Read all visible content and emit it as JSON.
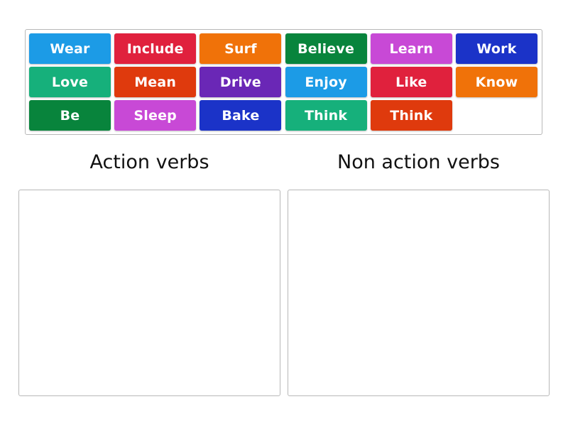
{
  "tiles": [
    {
      "label": "Wear",
      "color": "#1c9be6"
    },
    {
      "label": "Include",
      "color": "#e0213d"
    },
    {
      "label": "Surf",
      "color": "#f07209"
    },
    {
      "label": "Believe",
      "color": "#08843c"
    },
    {
      "label": "Learn",
      "color": "#c849d6"
    },
    {
      "label": "Work",
      "color": "#1b33c8"
    },
    {
      "label": "Love",
      "color": "#16b07b"
    },
    {
      "label": "Mean",
      "color": "#df3a0d"
    },
    {
      "label": "Drive",
      "color": "#6a27b6"
    },
    {
      "label": "Enjoy",
      "color": "#1c9be6"
    },
    {
      "label": "Like",
      "color": "#e0213d"
    },
    {
      "label": "Know",
      "color": "#f07209"
    },
    {
      "label": "Be",
      "color": "#08843c"
    },
    {
      "label": "Sleep",
      "color": "#c849d6"
    },
    {
      "label": "Bake",
      "color": "#1b33c8"
    },
    {
      "label": "Think",
      "color": "#16b07b"
    },
    {
      "label": "Think",
      "color": "#df3a0d"
    }
  ],
  "groups": [
    {
      "title": "Action verbs"
    },
    {
      "title": "Non action verbs"
    }
  ]
}
